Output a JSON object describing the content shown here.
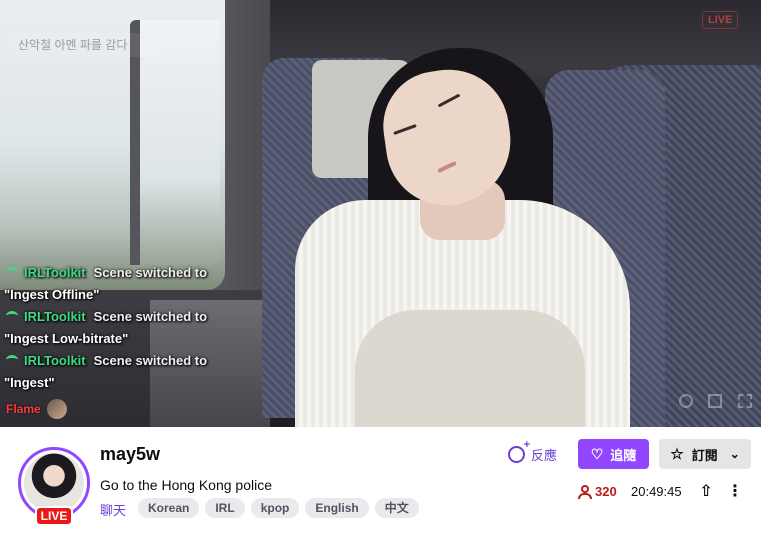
{
  "video": {
    "live_indicator": "LIVE",
    "search_hint": "산악철 아멘 파를 감다"
  },
  "chat": {
    "messages": [
      {
        "user": "IRLToolkit",
        "text": "Scene switched to",
        "continuation": "\"Ingest Offline\""
      },
      {
        "user": "IRLToolkit",
        "text": "Scene switched to",
        "continuation": "\"Ingest Low-bitrate\""
      },
      {
        "user": "IRLToolkit",
        "text": "Scene switched to",
        "continuation": "\"Ingest\""
      }
    ],
    "bottom_user": "Flame"
  },
  "channel": {
    "name": "may5w",
    "live_badge": "LIVE",
    "title": "Go to the Hong Kong police",
    "category": "聊天",
    "tags": [
      "Korean",
      "IRL",
      "kpop",
      "English",
      "中文"
    ]
  },
  "actions": {
    "react_label": "反應",
    "follow_label": "追隨",
    "subscribe_label": "訂閱"
  },
  "stats": {
    "viewers": "320",
    "uptime": "20:49:45"
  },
  "icons": {
    "react": "emoji-plus-icon",
    "follow": "heart-icon",
    "subscribe": "star-icon",
    "viewers": "person-icon",
    "share": "share-icon",
    "more": "more-vertical-icon"
  },
  "colors": {
    "accent": "#9147ff",
    "live": "#e91916",
    "viewer_count": "#bf1a1a",
    "chat_user": "#3ddc84"
  }
}
